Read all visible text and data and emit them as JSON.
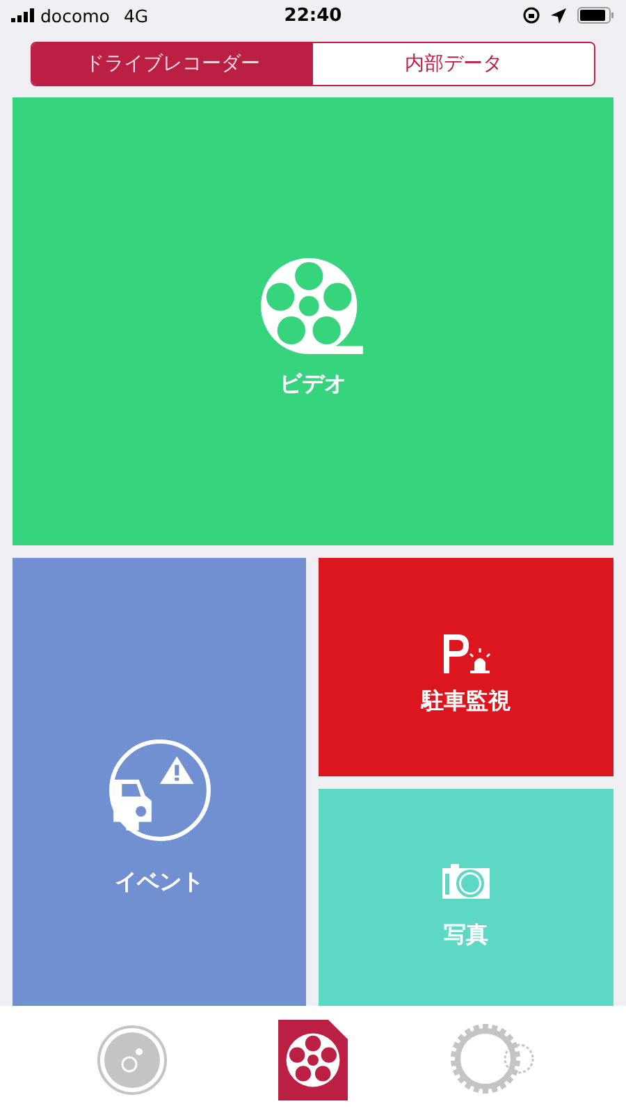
{
  "status_bar": {
    "carrier": "docomo",
    "network": "4G",
    "time": "22:40"
  },
  "segments": [
    {
      "label": "ドライブレコーダー",
      "selected": true
    },
    {
      "label": "内部データ",
      "selected": false
    }
  ],
  "tiles": [
    {
      "kind": "video",
      "label": "ビデオ",
      "color": "#36d47c"
    },
    {
      "kind": "event",
      "label": "イベント",
      "color": "#7090d2"
    },
    {
      "kind": "parking",
      "label": "駐車監視",
      "color": "#dc161e"
    },
    {
      "kind": "photo",
      "label": "写真",
      "color": "#5cd8c4"
    }
  ],
  "tab_bar": [
    {
      "kind": "disc",
      "selected": false
    },
    {
      "kind": "reel",
      "selected": true
    },
    {
      "kind": "gear",
      "selected": false
    }
  ]
}
